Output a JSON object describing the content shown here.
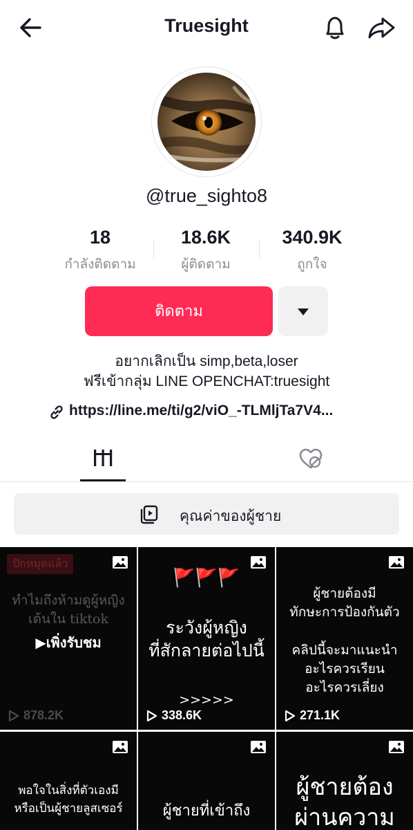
{
  "header": {
    "title": "Truesight",
    "back_icon": "arrow-left-icon",
    "bell_icon": "bell-icon",
    "share_icon": "share-arrow-icon"
  },
  "profile": {
    "avatar": "tiger-eye-avatar",
    "handle": "@true_sighto8",
    "stats": [
      {
        "value": "18",
        "label": "กำลังติดตาม"
      },
      {
        "value": "18.6K",
        "label": "ผู้ติดตาม"
      },
      {
        "value": "340.9K",
        "label": "ถูกใจ"
      }
    ],
    "follow_label": "ติดตาม",
    "bio_line1": "อยากเลิกเป็น simp,beta,loser",
    "bio_line2": "ฟรีเข้ากลุ่ม LINE OPENCHAT:truesight",
    "link_text": "https://line.me/ti/g2/viO_-TLMljTa7V4..."
  },
  "tabs": {
    "grid_icon": "video-grid-icon",
    "liked_icon": "liked-hidden-heart-icon"
  },
  "playlist": {
    "label": "คุณค่าของผู้ชาย",
    "icon": "playlist-icon"
  },
  "videos": [
    {
      "pinned": "ปักหมุดแล้ว",
      "line1": "ทำไมถึงห้ามดูผู้หญิง",
      "line2": "เต้นใน tiktok",
      "watched": "เพิ่งรับชม",
      "views": "878.2K"
    },
    {
      "flags": "🚩🚩🚩",
      "line1": "ระวังผู้หญิง",
      "line2": "ที่สักลายต่อไปนี้",
      "line3": ">>>>>",
      "views": "338.6K"
    },
    {
      "line1": "ผู้ชายต้องมี",
      "line2": "ทักษะการป้องกันตัว",
      "line3": "คลิปนี้จะมาแนะนำ",
      "line4": "อะไรควรเรียน",
      "line5": "อะไรควรเลี่ยง",
      "views": "271.1K"
    },
    {
      "line1": "พอใจในสิ่งที่ตัวเองมี",
      "line2": "หรือเป็นผู้ชายลูสเซอร์"
    },
    {
      "line1": "ผู้ชายที่เข้าถึง"
    },
    {
      "line1": "ผู้ชายต้อง",
      "line2": "ผ่านความ"
    }
  ]
}
